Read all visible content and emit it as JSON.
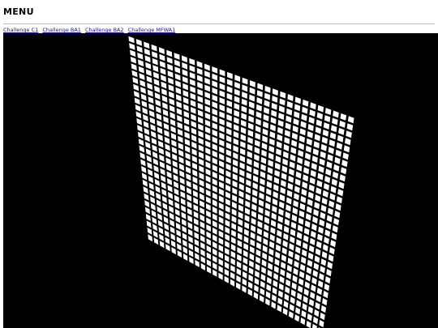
{
  "header": {
    "title": "MENU"
  },
  "nav": {
    "links": [
      {
        "label": "Challenge C1"
      },
      {
        "label": "Challenge BA1"
      },
      {
        "label": "Challenge BA2"
      },
      {
        "label": "Challenge MFWA1"
      }
    ]
  },
  "scene": {
    "background": "#000000",
    "cell_color": "#ffffff",
    "grid_columns": 30,
    "grid_rows": 30
  }
}
